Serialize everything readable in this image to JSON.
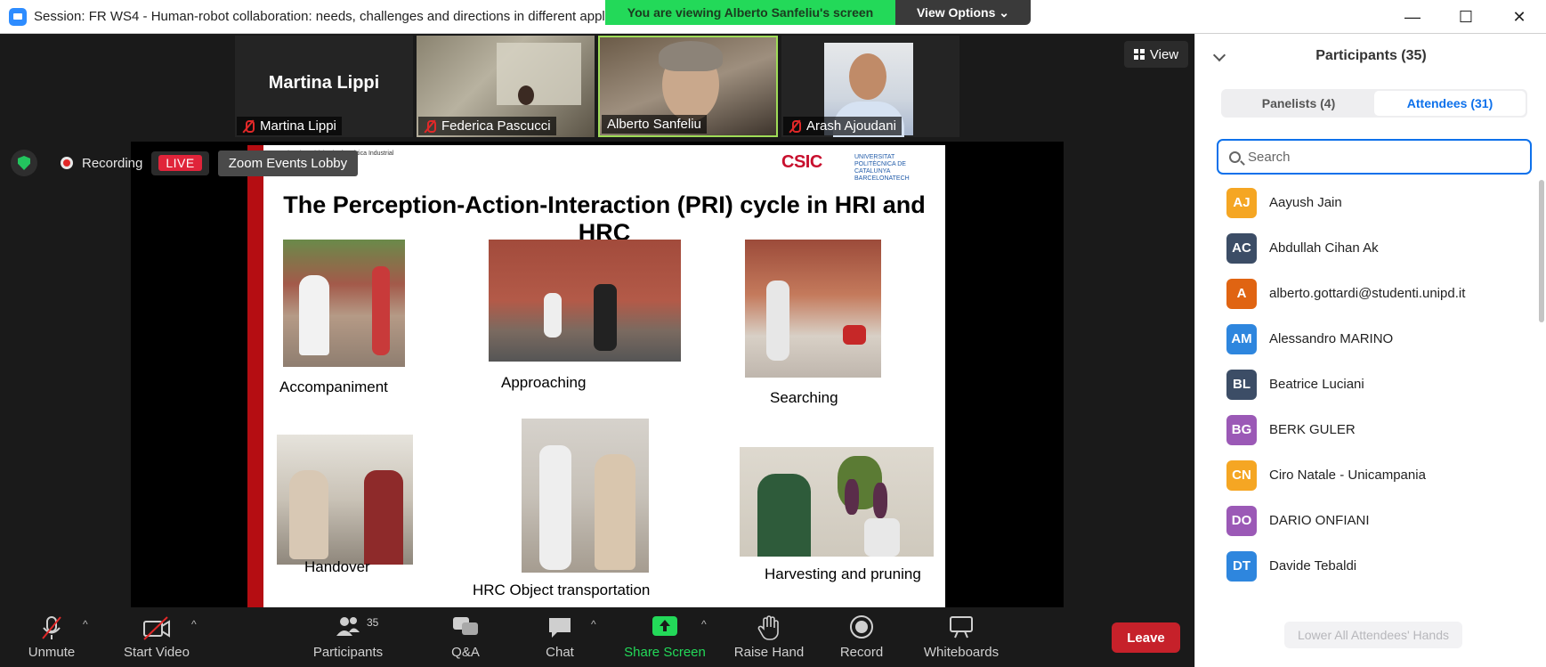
{
  "window": {
    "title": "Session: FR WS4 - Human-robot collaboration: needs, challenges and directions in different applic",
    "minimize": "—",
    "maximize": "☐",
    "close": "✕"
  },
  "banner": {
    "viewing": "You are viewing Alberto Sanfeliu's screen",
    "view_options": "View Options ⌄"
  },
  "thumbnails": [
    {
      "name": "Martina Lippi",
      "big_name": "Martina Lippi",
      "muted": true
    },
    {
      "name": "Federica Pascucci",
      "muted": true
    },
    {
      "name": "Alberto Sanfeliu",
      "muted": false
    },
    {
      "name": "Arash Ajoudani",
      "muted": true
    }
  ],
  "view_button": "View",
  "status": {
    "recording": "Recording",
    "live": "LIVE",
    "lobby": "Zoom Events Lobby"
  },
  "slide": {
    "title": "The Perception-Action-Interaction (PRI) cycle in HRI and HRC",
    "institute": "Institut de Robòtica i Informàtica Industrial",
    "csic": "CSIC",
    "upc": "UNIVERSITAT POLITÈCNICA DE CATALUNYA BARCELONATECH",
    "captions": [
      "Accompaniment",
      "Approaching",
      "Searching",
      "Handover",
      "HRC Object transportation",
      "Harvesting and pruning"
    ]
  },
  "toolbar": {
    "unmute": "Unmute",
    "start_video": "Start Video",
    "participants": "Participants",
    "participants_count": "35",
    "qa": "Q&A",
    "chat": "Chat",
    "share_screen": "Share Screen",
    "raise_hand": "Raise Hand",
    "record": "Record",
    "whiteboards": "Whiteboards",
    "leave": "Leave",
    "share_color": "#23d959",
    "leave_color": "#c6212a"
  },
  "panel": {
    "title": "Participants (35)",
    "tabs": [
      "Panelists (4)",
      "Attendees (31)"
    ],
    "active_tab": "Attendees (31)",
    "search_placeholder": "Search",
    "attendees": [
      {
        "initials": "AJ",
        "name": "Aayush Jain",
        "color": "#f5a623"
      },
      {
        "initials": "AC",
        "name": "Abdullah Cihan Ak",
        "color": "#3c4d66"
      },
      {
        "initials": "A",
        "name": "alberto.gottardi@studenti.unipd.it",
        "color": "#e06412"
      },
      {
        "initials": "AM",
        "name": "Alessandro MARINO",
        "color": "#2e86de"
      },
      {
        "initials": "BL",
        "name": "Beatrice Luciani",
        "color": "#3c4d66"
      },
      {
        "initials": "BG",
        "name": "BERK GULER",
        "color": "#9b59b6"
      },
      {
        "initials": "CN",
        "name": "Ciro Natale - Unicampania",
        "color": "#f5a623"
      },
      {
        "initials": "DO",
        "name": "DARIO ONFIANI",
        "color": "#9b59b6"
      },
      {
        "initials": "DT",
        "name": "Davide Tebaldi",
        "color": "#2e86de"
      }
    ],
    "lower_hands": "Lower All Attendees' Hands",
    "accent": "#0e71eb"
  }
}
